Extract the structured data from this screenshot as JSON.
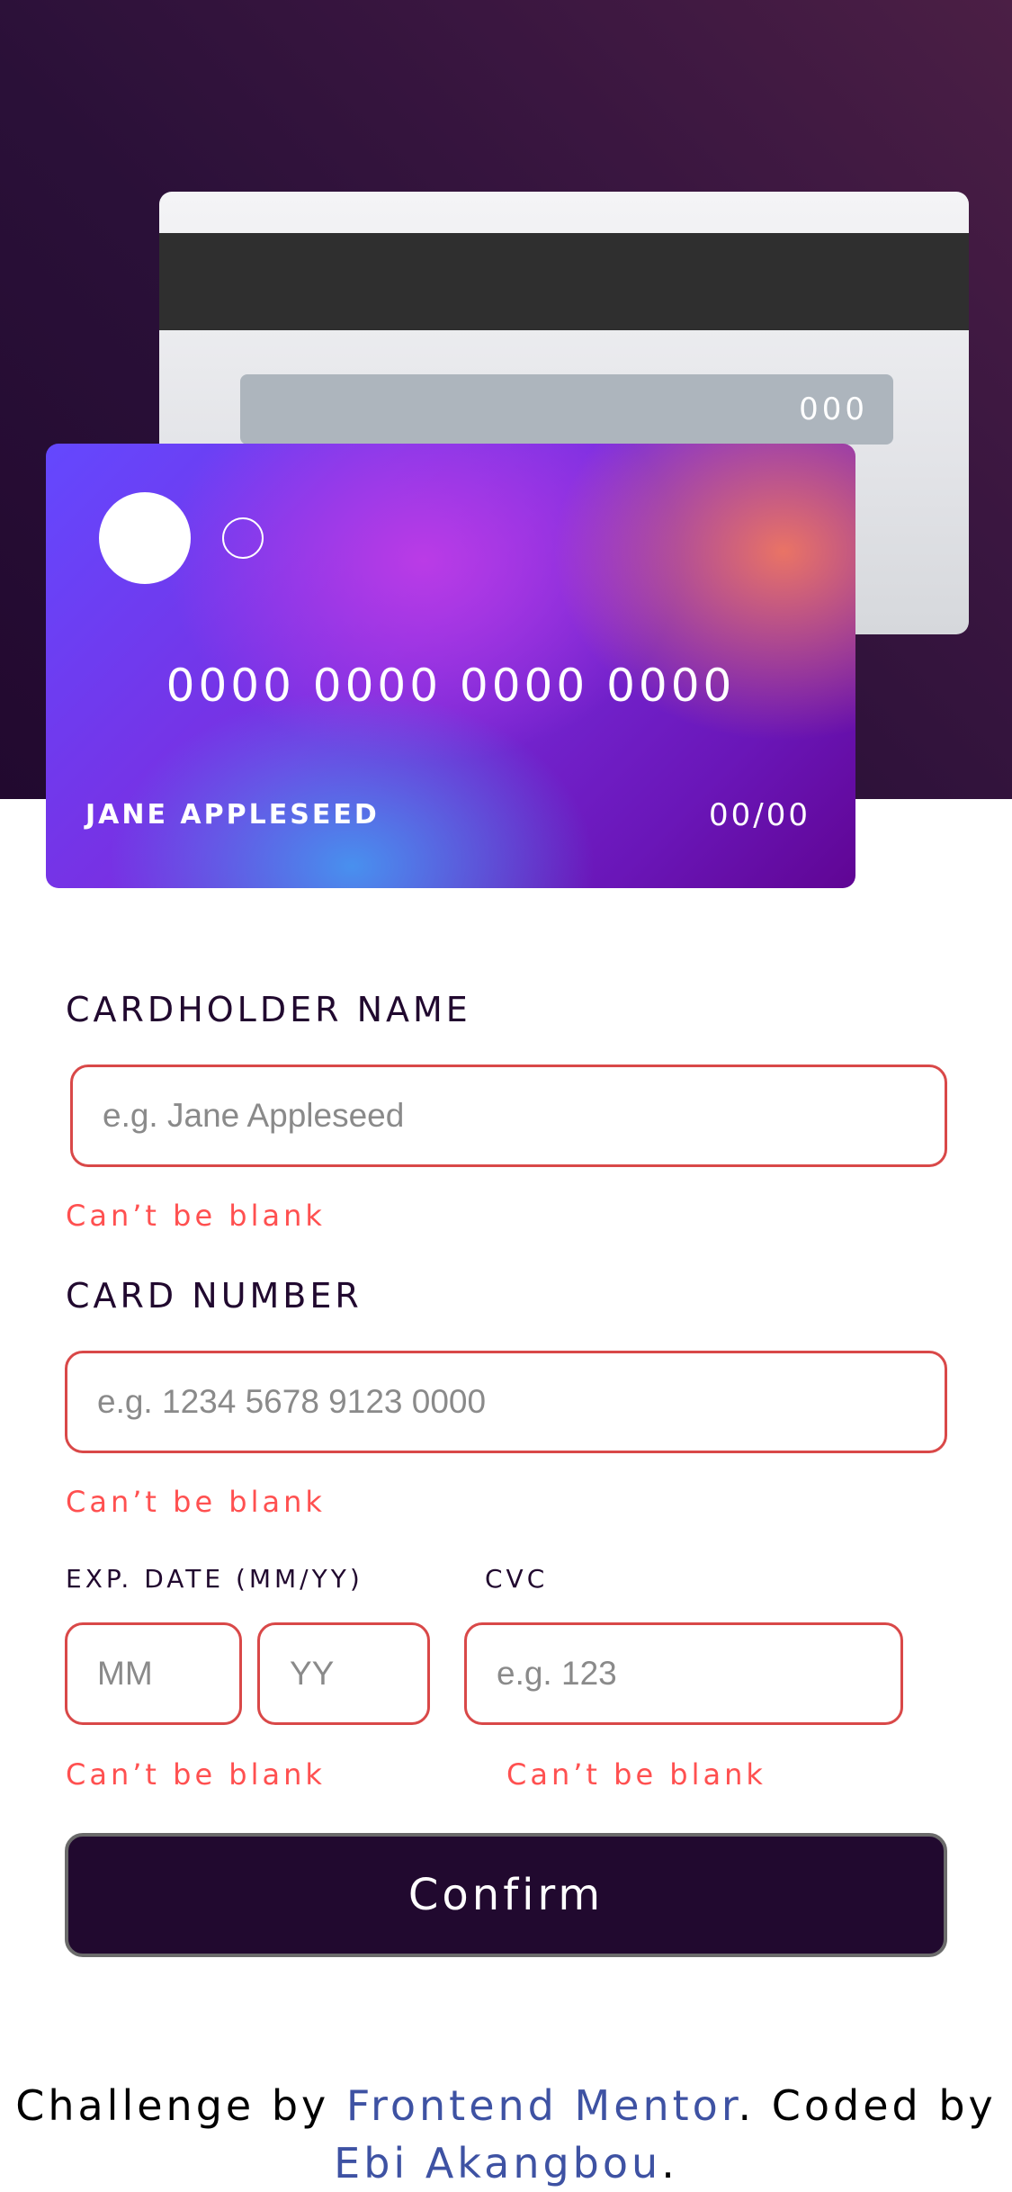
{
  "card_back": {
    "cvc": "000"
  },
  "card_front": {
    "number": "0000 0000 0000 0000",
    "name": "JANE APPLESEED",
    "expiry": "00/00"
  },
  "form": {
    "cardholder": {
      "label": "CARDHOLDER NAME",
      "placeholder": "e.g. Jane Appleseed",
      "error": "Can’t be blank"
    },
    "number": {
      "label": "CARD NUMBER",
      "placeholder": "e.g. 1234 5678 9123 0000",
      "error": "Can’t be blank"
    },
    "expiry": {
      "label": "EXP. DATE (MM/YY)",
      "month_placeholder": "MM",
      "year_placeholder": "YY",
      "error": "Can’t be blank"
    },
    "cvc": {
      "label": "CVC",
      "placeholder": "e.g. 123",
      "error": "Can’t be blank"
    },
    "confirm_label": "Confirm"
  },
  "footer": {
    "prefix": "Challenge by ",
    "link1": "Frontend Mentor",
    "middle": ". Coded by ",
    "link2": "Ebi Akangbou",
    "suffix": "."
  },
  "colors": {
    "error": "#ff5050",
    "dark_violet": "#21092f",
    "link": "#3e52a3"
  }
}
